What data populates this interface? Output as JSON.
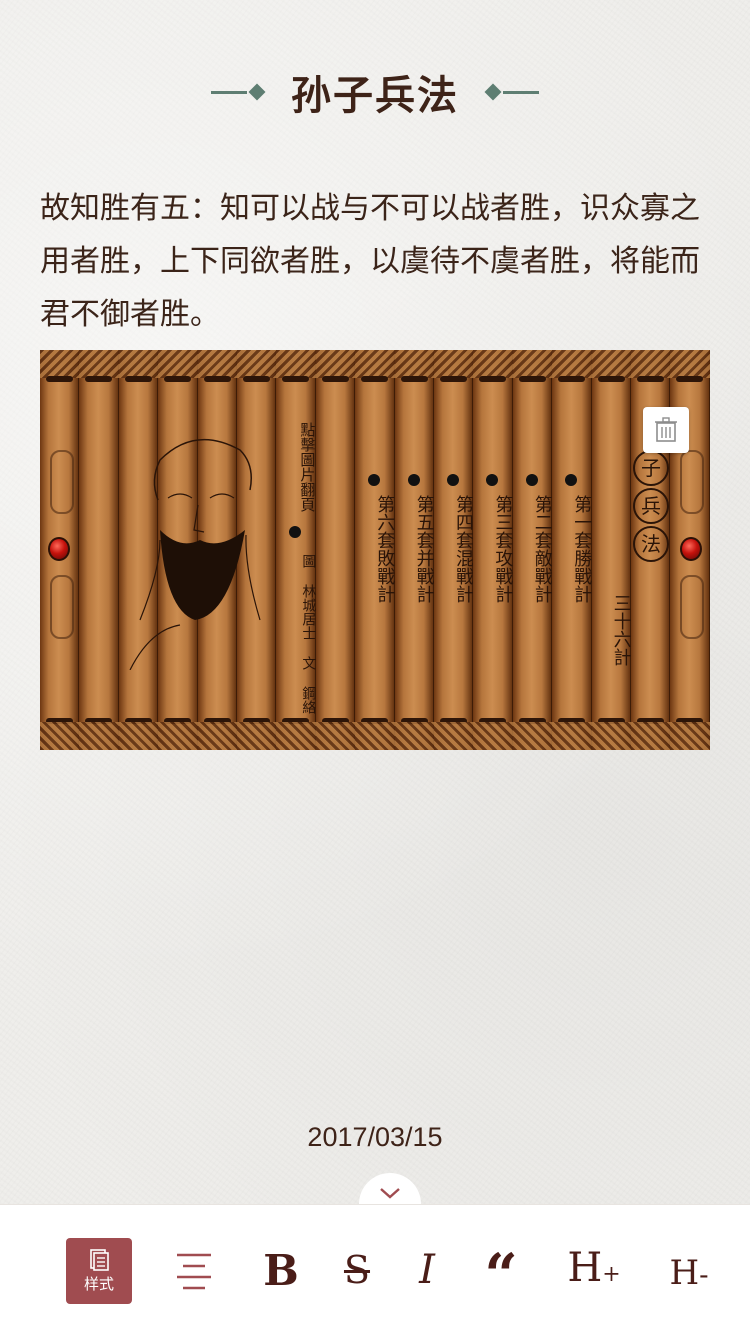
{
  "article": {
    "title": "孙子兵法",
    "body": "故知胜有五：知可以战与不可以战者胜，识众寡之用者胜，上下同欲者胜，以虞待不虞者胜，将能而君不御者胜。",
    "date": "2017/03/15"
  },
  "image": {
    "slips": [
      {
        "text": "點擊圖片翻頁"
      },
      {
        "text": "圖 林城居士 文 鋼絡"
      },
      {
        "text": "第六套敗戰計"
      },
      {
        "text": "第五套并戰計"
      },
      {
        "text": "第四套混戰計"
      },
      {
        "text": "第三套攻戰計"
      },
      {
        "text": "第二套敵戰計"
      },
      {
        "text": "第一套勝戰計"
      },
      {
        "text": "三十六計"
      }
    ],
    "circle_chars": [
      "子",
      "兵",
      "法"
    ]
  },
  "toolbar": {
    "style_label": "样式",
    "bold_label": "B",
    "strike_label": "S",
    "italic_label": "I",
    "quote_label": "“",
    "h_plus_label": "H",
    "h_plus_sign": "+",
    "h_minus_label": "H",
    "h_minus_sign": "-"
  },
  "colors": {
    "accent": "#a04c50",
    "text": "#3b2419",
    "ornament": "#5e7e72"
  },
  "icons": {
    "delete": "trash-icon",
    "collapse": "chevron-down-icon",
    "style": "document-icon",
    "align": "align-center-icon"
  }
}
